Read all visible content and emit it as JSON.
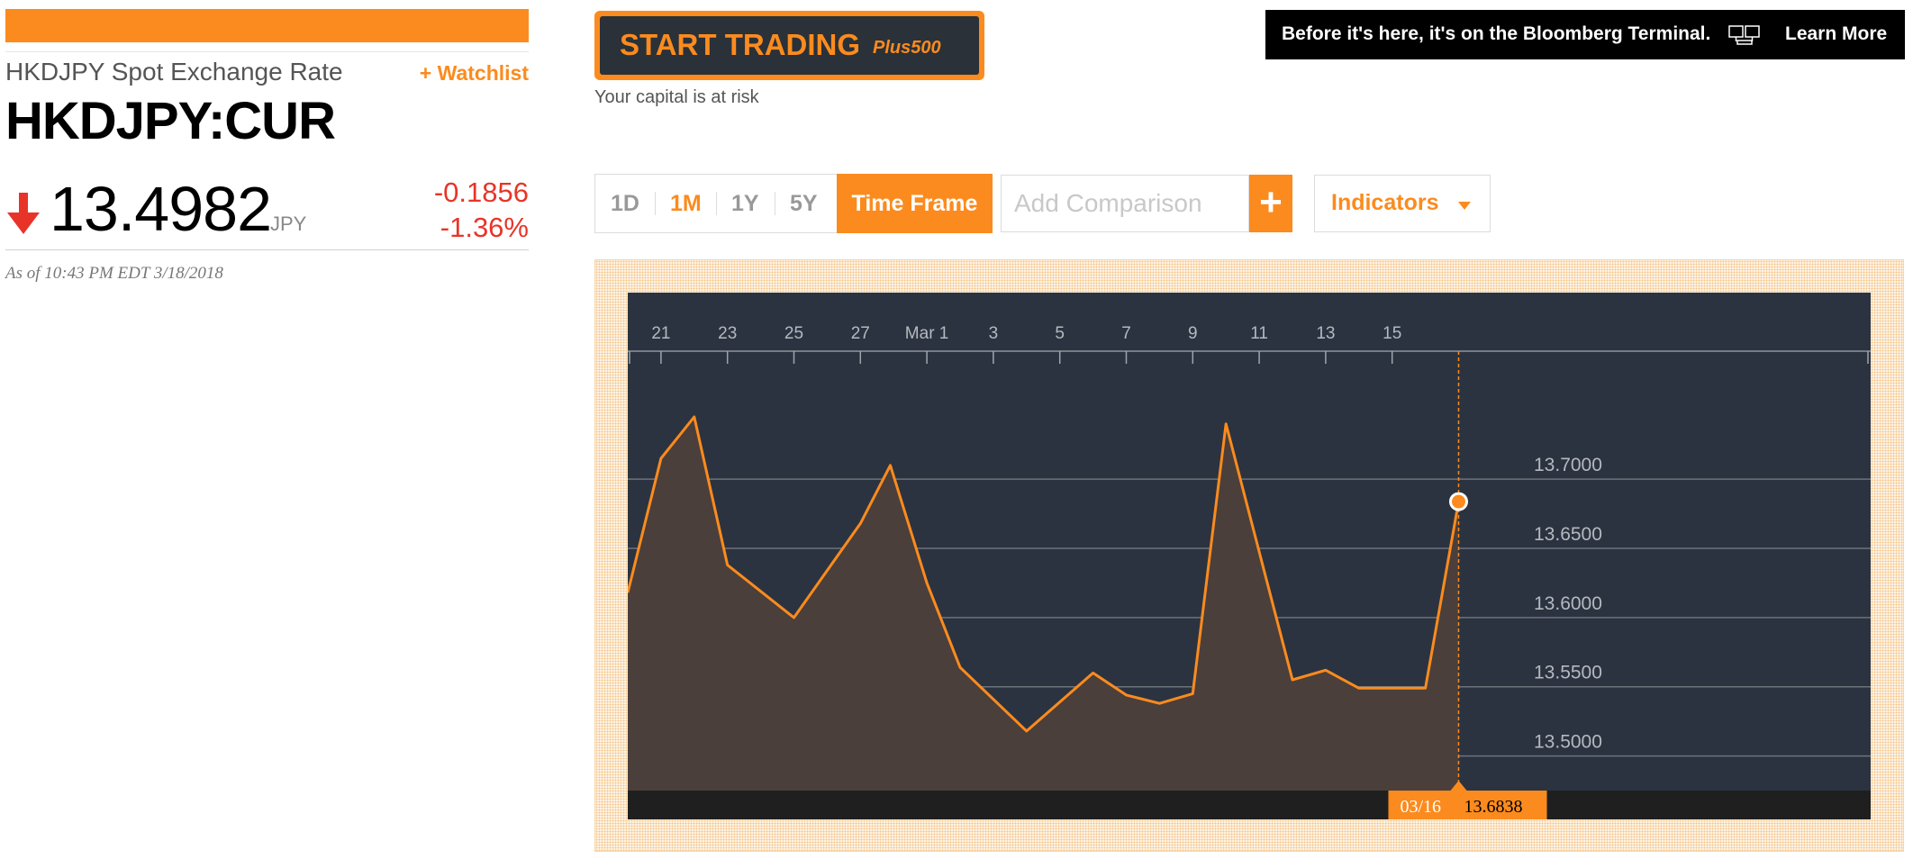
{
  "quote": {
    "name": "HKDJPY Spot Exchange Rate",
    "watchlist_label": "+ Watchlist",
    "ticker": "HKDJPY:CUR",
    "direction": "down",
    "price": "13.4982",
    "currency": "JPY",
    "change": "-0.1856",
    "change_percent": "-1.36%",
    "as_of": "As of 10:43 PM EDT 3/18/2018"
  },
  "ad": {
    "button_label": "START TRADING",
    "brand": "Plus500",
    "disclaimer": "Your capital is at risk"
  },
  "banner": {
    "text": "Before it's here, it's on the Bloomberg Terminal.",
    "icon": "terminal-icon",
    "link_label": "Learn More"
  },
  "controls": {
    "ranges": [
      "1D",
      "1M",
      "1Y",
      "5Y"
    ],
    "active_range": "1M",
    "timeframe_label": "Time Frame",
    "comparison_placeholder": "Add Comparison",
    "add_label": "+",
    "indicators_label": "Indicators"
  },
  "colors": {
    "accent": "#fb8b1e",
    "negative": "#e83428",
    "chart_background": "#2b3340",
    "area_fill": "#4a3f3b"
  },
  "chart_data": {
    "type": "area",
    "x_tick_labels": [
      "21",
      "23",
      "25",
      "27",
      "Mar 1",
      "3",
      "5",
      "7",
      "9",
      "11",
      "13",
      "15"
    ],
    "x_tick_day_index": [
      1,
      3,
      5,
      7,
      9,
      11,
      13,
      15,
      17,
      19,
      21,
      23
    ],
    "y_ticks": [
      "13.7000",
      "13.6500",
      "13.6000",
      "13.5500",
      "13.5000"
    ],
    "y_tick_values": [
      13.7,
      13.65,
      13.6,
      13.55,
      13.5
    ],
    "ylim": [
      13.475,
      13.7925
    ],
    "series": [
      {
        "x": [
          0.0,
          0.0,
          1.0,
          2.0,
          3.0,
          5.0,
          6.0,
          7.0,
          7.9,
          9.0,
          10.0,
          12.0,
          14.0,
          15.0,
          16.0,
          17.0,
          18.0,
          20.0,
          21.0,
          22.0,
          23.0,
          24.0,
          25.0
        ],
        "values": [
          13.618,
          13.618,
          13.715,
          13.745,
          13.638,
          13.6,
          13.634,
          13.668,
          13.71,
          13.625,
          13.564,
          13.518,
          13.56,
          13.544,
          13.538,
          13.545,
          13.74,
          13.555,
          13.562,
          13.549,
          13.549,
          13.549,
          13.6838
        ]
      }
    ],
    "tooltip": {
      "date": "03/16",
      "value": "13.6838"
    },
    "grid": true
  }
}
